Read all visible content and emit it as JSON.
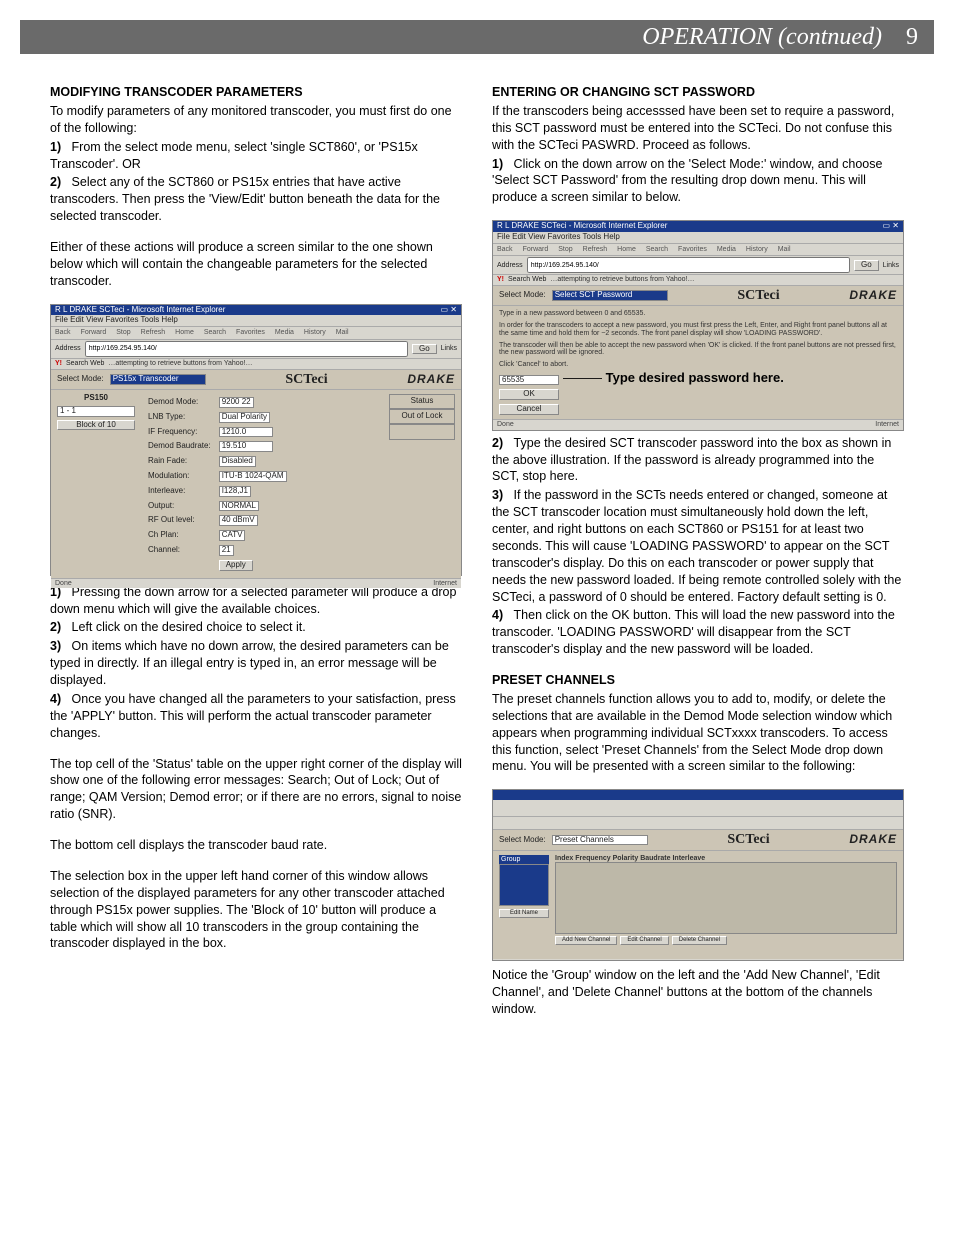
{
  "header": {
    "title": "OPERATION (contnued)",
    "page": "9"
  },
  "left": {
    "h1": "MODIFYING TRANSCODER PARAMETERS",
    "p1": "To modify parameters of any monitored transcoder, you must first do one of the following:",
    "l1n": "1)",
    "l1": "From the select mode menu, select 'single SCT860', or 'PS15x Transcoder'.   OR",
    "l2n": "2)",
    "l2": "Select any of the SCT860 or PS15x entries that have active transcoders.  Then  press the 'View/Edit' button beneath the data for the selected transcoder.",
    "p2": "Either of these actions will produce a screen similar to the one shown below which will contain the changeable parameters for the selected transcoder.",
    "s1": {
      "title": "R L DRAKE SCTeci - Microsoft Internet Explorer",
      "menu": "File   Edit   View   Favorites   Tools   Help",
      "tbitems": [
        "Back",
        "Forward",
        "Stop",
        "Refresh",
        "Home",
        "Search",
        "Favorites",
        "Media",
        "History",
        "Mail"
      ],
      "addrLabel": "Address",
      "addr": "http://169.254.95.140/",
      "go": "Go",
      "links": "Links",
      "searchlabel": "Search Web",
      "searchhint": "…attempting to retrieve buttons from Yahoo!…",
      "selmode": "Select Mode:",
      "selval": "PS15x  Transcoder",
      "scteci": "SCTeci",
      "drake": "DRAKE",
      "psbox": "PS150",
      "range": "1 -   1",
      "block": "Block of 10",
      "rows": [
        [
          "Demod Mode:",
          "9200        22"
        ],
        [
          "LNB Type:",
          "Dual Polarity"
        ],
        [
          "IF Frequency:",
          "1210.0"
        ],
        [
          "Demod Baudrate:",
          "19.510"
        ],
        [
          "Rain Fade:",
          "Disabled"
        ],
        [
          "Modulation:",
          "ITU-B 1024-QAM"
        ],
        [
          "Interleave:",
          "I128,J1"
        ],
        [
          "Output:",
          "NORMAL"
        ],
        [
          "RF Out level:",
          "40 dBmV"
        ],
        [
          "Ch Plan:",
          "CATV"
        ],
        [
          "Channel:",
          "21"
        ]
      ],
      "apply": "Apply",
      "statusHdr": "Status",
      "statusVal": "Out of Lock",
      "done": "Done",
      "inet": "Internet"
    },
    "a1n": "1)",
    "a1": "Pressing the down arrow for a selected parameter will produce a drop down menu which will give the available choices.",
    "a2n": "2)",
    "a2": "Left click on the desired choice to select it.",
    "a3n": "3)",
    "a3": "On items which have no down arrow, the desired parameters can be typed in directly.  If an illegal entry is typed in, an error message will be displayed.",
    "a4n": "4)",
    "a4": "Once you have changed all the parameters to your satisfaction, press the 'APPLY' button.  This will perform the actual transcoder parameter changes.",
    "p3": "The top cell of the 'Status' table on the upper right corner of the display will show one of the following error messages: Search; Out of Lock; Out of range; QAM Version; Demod error; or if there are no errors, signal to noise ratio (SNR).",
    "p4": "The bottom cell displays the transcoder baud rate.",
    "p5": "The selection box in the upper left hand corner of this window allows selection of the displayed parameters for any other transcoder attached through PS15x power supplies.  The 'Block of 10' button will produce a table which will show all 10 transcoders in the group containing the transcoder displayed in the box."
  },
  "right": {
    "h1": "ENTERING OR CHANGING SCT PASSWORD",
    "p1": "If the transcoders being accesssed have been set to require a password, this SCT password must be entered into the SCTeci. Do not confuse this with the SCTeci PASWRD. Proceed as follows.",
    "r1n": "1)",
    "r1": "Click on the down arrow on the 'Select Mode:' window, and choose 'Select SCT Password' from the resulting drop down menu.  This will produce a screen similar to below.",
    "s2": {
      "title": "R L DRAKE SCTeci - Microsoft Internet Explorer",
      "menu": "File   Edit   View   Favorites   Tools   Help",
      "tbitems": [
        "Back",
        "Forward",
        "Stop",
        "Refresh",
        "Home",
        "Search",
        "Favorites",
        "Media",
        "History",
        "Mail"
      ],
      "addrLabel": "Address",
      "addr": "http://169.254.95.140/",
      "go": "Go",
      "links": "Links",
      "searchlabel": "Search Web",
      "searchhint": "…attempting to retrieve buttons from Yahoo!…",
      "selmode": "Select Mode:",
      "selval": "Select SCT Password",
      "scteci": "SCTeci",
      "drake": "DRAKE",
      "note1": "Type in a new password between 0 and 65535.",
      "note2": "In order for the transcoders to accept a new password, you must first press the Left, Enter, and Right front panel buttons all at the same time and hold them for ~2 seconds. The front panel display will show 'LOADING PASSWORD'.",
      "note3": "The transcoder will then be able to accept the new password when 'OK' is clicked. If the front panel buttons are not pressed first, the new password will be ignored.",
      "note4": "Click 'Cancel' to abort.",
      "pwval": "65535",
      "ok": "OK",
      "cancel": "Cancel",
      "annot": "Type desired password here.",
      "done": "Done",
      "inet": "Internet"
    },
    "r2n": "2)",
    "r2": "Type the desired SCT transcoder password into the box as shown in the above illustration. If the password is already programmed into the SCT, stop here.",
    "r3n": "3)",
    "r3": "If the password in the SCTs needs entered or changed, someone at the SCT transcoder location must simultaneously hold down the left, center, and right buttons on each SCT860 or PS151 for at least two seconds.  This will cause 'LOADING PASSWORD' to appear on the SCT transcoder's display. Do this on each transcoder or power supply that needs the new password loaded. If being remote controlled solely with the SCTeci, a password of 0 should be entered. Factory default setting is 0.",
    "r4n": "4)",
    "r4": "Then click on the OK button.  This will load the new password into the transcoder.  'LOADING PASSWORD' will disappear from the SCT transcoder's display and the new password will be loaded.",
    "h2": "PRESET CHANNELS",
    "p2": "The preset channels function allows you to add to, modify, or delete  the selections that  are available in the Demod Mode selection window which appears when programming individual SCTxxxx transcoders.  To access this function, select 'Preset Channels'  from the Select Mode drop down menu.  You will be presented with a screen similar to the following:",
    "s3": {
      "selmode": "Select Mode:",
      "selval": "Preset Channels",
      "scteci": "SCTeci",
      "drake": "DRAKE",
      "group": "Group",
      "groupbtn": "Edit Name",
      "hdrs": "Index  Frequency Polarity Baudrate Interleave",
      "addbtn": "Add New Channel",
      "editbtn": "Edit Channel",
      "delbtn": "Delete Channel"
    },
    "p3": "Notice the 'Group' window on the left and the 'Add New Channel', 'Edit Channel', and 'Delete Channel' buttons at the bottom of the channels window."
  }
}
